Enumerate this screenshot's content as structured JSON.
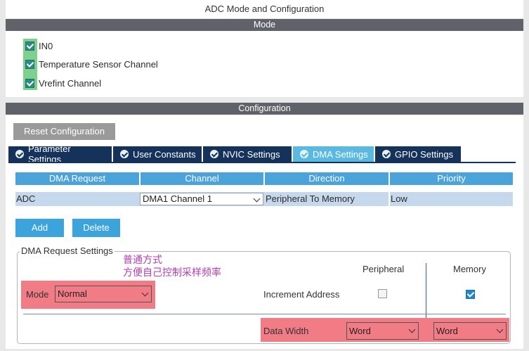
{
  "window_title": "ADC Mode and Configuration",
  "mode_section": {
    "title": "Mode",
    "channels": [
      {
        "label": "IN0",
        "checked": true
      },
      {
        "label": "Temperature Sensor Channel",
        "checked": true
      },
      {
        "label": "Vrefint Channel",
        "checked": true
      }
    ]
  },
  "config_section": {
    "title": "Configuration",
    "reset_label": "Reset Configuration",
    "tabs": [
      {
        "label": "Parameter Settings",
        "active": false
      },
      {
        "label": "User Constants",
        "active": false
      },
      {
        "label": "NVIC Settings",
        "active": false
      },
      {
        "label": "DMA Settings",
        "active": true
      },
      {
        "label": "GPIO Settings",
        "active": false
      }
    ]
  },
  "dma_table": {
    "headers": [
      "DMA Request",
      "Channel",
      "Direction",
      "Priority"
    ],
    "rows": [
      {
        "request": "ADC",
        "channel": "DMA1 Channel 1",
        "direction": "Peripheral To Memory",
        "priority": "Low"
      }
    ]
  },
  "buttons": {
    "add": "Add",
    "delete": "Delete"
  },
  "dma_request_settings": {
    "legend": "DMA Request Settings",
    "annotation_line1": "普通方式",
    "annotation_line2": "方便自己控制采样频率",
    "peripheral_header": "Peripheral",
    "memory_header": "Memory",
    "mode_label": "Mode",
    "mode_value": "Normal",
    "increment_label": "Increment Address",
    "peripheral_increment": false,
    "memory_increment": true,
    "data_width_label": "Data Width",
    "peripheral_width": "Word",
    "memory_width": "Word"
  },
  "colors": {
    "highlight_green": "#7fd08a",
    "highlight_red": "#f27c86",
    "tab_dark": "#14325a",
    "tab_active": "#5ab9e0",
    "header_blue": "#4aa3da",
    "annotation": "#b23dac"
  }
}
